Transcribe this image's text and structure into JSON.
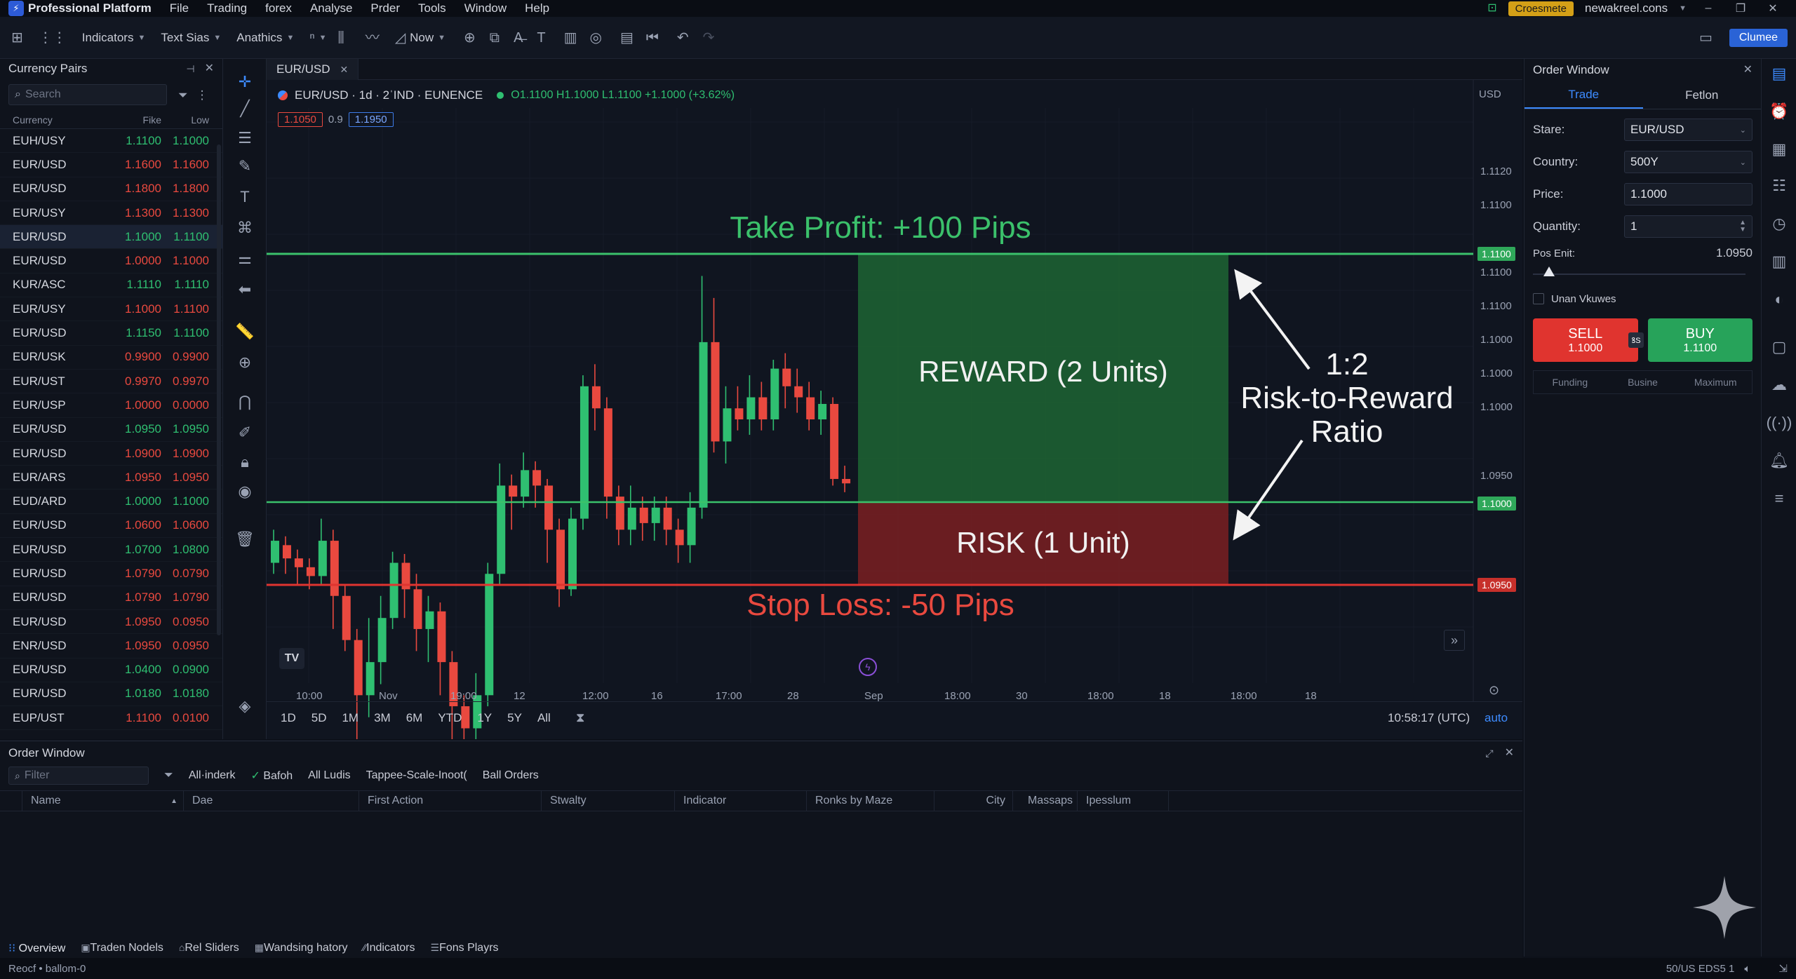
{
  "menubar": {
    "app_name": "Professional Platform",
    "items": [
      "File",
      "Trading",
      "forex",
      "Analyse",
      "Prder",
      "Tools",
      "Window",
      "Help"
    ],
    "badge": "Croesmete",
    "account": "newakreel.cons"
  },
  "toolbar": {
    "indicators": "Indicators",
    "text_size": "Text Sias",
    "analytics": "Anathics",
    "now": "Now",
    "action_button": "Clumee"
  },
  "pairs_panel": {
    "title": "Currency Pairs",
    "search_placeholder": "Search",
    "col_currency": "Currency",
    "col_price": "Fike",
    "col_low": "Low",
    "rows": [
      {
        "pair": "EUH/USY",
        "price": "1.1100",
        "low": "1.1000",
        "dir": "up"
      },
      {
        "pair": "EUR/USD",
        "price": "1.1600",
        "low": "1.1600",
        "dir": "dn"
      },
      {
        "pair": "EUR/USD",
        "price": "1.1800",
        "low": "1.1800",
        "dir": "dn"
      },
      {
        "pair": "EUR/USY",
        "price": "1.1300",
        "low": "1.1300",
        "dir": "dn"
      },
      {
        "pair": "EUR/USD",
        "price": "1.1000",
        "low": "1.1100",
        "dir": "up",
        "selected": true
      },
      {
        "pair": "EUR/USD",
        "price": "1.0000",
        "low": "1.1000",
        "dir": "dn"
      },
      {
        "pair": "KUR/ASC",
        "price": "1.1110",
        "low": "1.1110",
        "dir": "up"
      },
      {
        "pair": "EUR/USY",
        "price": "1.1000",
        "low": "1.1100",
        "dir": "dn"
      },
      {
        "pair": "EUR/USD",
        "price": "1.1150",
        "low": "1.1100",
        "dir": "up"
      },
      {
        "pair": "EUR/USK",
        "price": "0.9900",
        "low": "0.9900",
        "dir": "dn"
      },
      {
        "pair": "EUR/UST",
        "price": "0.9970",
        "low": "0.9970",
        "dir": "dn"
      },
      {
        "pair": "EUR/USP",
        "price": "1.0000",
        "low": "0.0000",
        "dir": "dn"
      },
      {
        "pair": "EUR/USD",
        "price": "1.0950",
        "low": "1.0950",
        "dir": "up"
      },
      {
        "pair": "EUR/USD",
        "price": "1.0900",
        "low": "1.0900",
        "dir": "dn"
      },
      {
        "pair": "EUR/ARS",
        "price": "1.0950",
        "low": "1.0950",
        "dir": "dn"
      },
      {
        "pair": "EUD/ARD",
        "price": "1.0000",
        "low": "1.1000",
        "dir": "up"
      },
      {
        "pair": "EUR/USD",
        "price": "1.0600",
        "low": "1.0600",
        "dir": "dn"
      },
      {
        "pair": "EUR/USD",
        "price": "1.0700",
        "low": "1.0800",
        "dir": "up"
      },
      {
        "pair": "EUR/USD",
        "price": "1.0790",
        "low": "0.0790",
        "dir": "dn"
      },
      {
        "pair": "EUR/USD",
        "price": "1.0790",
        "low": "1.0790",
        "dir": "dn"
      },
      {
        "pair": "EUR/USD",
        "price": "1.0950",
        "low": "0.0950",
        "dir": "dn"
      },
      {
        "pair": "ENR/USD",
        "price": "1.0950",
        "low": "0.0950",
        "dir": "dn"
      },
      {
        "pair": "EUR/USD",
        "price": "1.0400",
        "low": "0.0900",
        "dir": "up"
      },
      {
        "pair": "EUR/USD",
        "price": "1.0180",
        "low": "1.0180",
        "dir": "up"
      },
      {
        "pair": "EUP/UST",
        "price": "1.1100",
        "low": "0.0100",
        "dir": "dn"
      }
    ]
  },
  "chart": {
    "tab": "EUR/USD",
    "symbol_line": "EUR/USD · 1d · 2ˈIND · EUNENCE",
    "ohlc": "O1.1100  H1.1000  L1.1100  +1.1000 (+3.62%)",
    "pill_sell": "1.1050",
    "pill_mid": "0.9",
    "pill_buy": "1.1950",
    "currency_label": "USD",
    "take_profit_label": "Take Profit: +100 Pips",
    "stop_loss_label": "Stop Loss: -50 Pips",
    "reward_label": "REWARD (2 Units)",
    "risk_label": "RISK (1 Unit)",
    "ratio_line1": "1:2",
    "ratio_line2": "Risk-to-Reward",
    "ratio_line3": "Ratio",
    "tp_tag": "1.1100",
    "entry_tag": "1.1000",
    "sl_tag": "1.0950",
    "periods": [
      "1D",
      "5D",
      "1M",
      "3M",
      "6M",
      "YTD",
      "1Y",
      "5Y",
      "All"
    ],
    "clock": "10:58:17 (UTC)",
    "auto": "auto",
    "logo": "TV"
  },
  "chart_data": {
    "type": "candlestick",
    "y_axis_labels": [
      "1.1120",
      "1.1100",
      "1.1100",
      "1.1100",
      "1.1000",
      "1.1000",
      "1.1000",
      "1.0950"
    ],
    "x_axis_labels": [
      "10:00",
      "Nov",
      "19:00",
      "12",
      "12:00",
      "16",
      "17:00",
      "28",
      "Sep",
      "18:00",
      "30",
      "18:00",
      "18",
      "18:00",
      "18"
    ],
    "levels": {
      "take_profit": 1.11,
      "entry": 1.1,
      "stop_loss": 1.095
    },
    "candles": [
      {
        "o": 1.096,
        "c": 1.097,
        "h": 1.0975,
        "l": 1.0955
      },
      {
        "o": 1.0968,
        "c": 1.0962,
        "h": 1.0972,
        "l": 1.0955
      },
      {
        "o": 1.0962,
        "c": 1.0958,
        "h": 1.0966,
        "l": 1.095
      },
      {
        "o": 1.0958,
        "c": 1.0954,
        "h": 1.0962,
        "l": 1.0948
      },
      {
        "o": 1.0954,
        "c": 1.097,
        "h": 1.098,
        "l": 1.095
      },
      {
        "o": 1.097,
        "c": 1.0945,
        "h": 1.0975,
        "l": 1.093
      },
      {
        "o": 1.0945,
        "c": 1.0925,
        "h": 1.095,
        "l": 1.092
      },
      {
        "o": 1.0925,
        "c": 1.09,
        "h": 1.093,
        "l": 1.088
      },
      {
        "o": 1.09,
        "c": 1.0915,
        "h": 1.0935,
        "l": 1.089
      },
      {
        "o": 1.0915,
        "c": 1.0935,
        "h": 1.0945,
        "l": 1.0905
      },
      {
        "o": 1.0935,
        "c": 1.096,
        "h": 1.0965,
        "l": 1.093
      },
      {
        "o": 1.096,
        "c": 1.0948,
        "h": 1.0964,
        "l": 1.0935
      },
      {
        "o": 1.0948,
        "c": 1.093,
        "h": 1.0955,
        "l": 1.092
      },
      {
        "o": 1.093,
        "c": 1.0938,
        "h": 1.0945,
        "l": 1.0915
      },
      {
        "o": 1.0938,
        "c": 1.0915,
        "h": 1.0942,
        "l": 1.09
      },
      {
        "o": 1.0915,
        "c": 1.0895,
        "h": 1.092,
        "l": 1.088
      },
      {
        "o": 1.0895,
        "c": 1.0885,
        "h": 1.09,
        "l": 1.0875
      },
      {
        "o": 1.0885,
        "c": 1.09,
        "h": 1.091,
        "l": 1.088
      },
      {
        "o": 1.09,
        "c": 1.0955,
        "h": 1.096,
        "l": 1.0895
      },
      {
        "o": 1.0955,
        "c": 1.0995,
        "h": 1.1005,
        "l": 1.095
      },
      {
        "o": 1.0995,
        "c": 1.099,
        "h": 1.1,
        "l": 1.0975
      },
      {
        "o": 1.099,
        "c": 1.1002,
        "h": 1.101,
        "l": 1.0985
      },
      {
        "o": 1.1002,
        "c": 1.0995,
        "h": 1.1006,
        "l": 1.0985
      },
      {
        "o": 1.0995,
        "c": 1.0975,
        "h": 1.0998,
        "l": 1.096
      },
      {
        "o": 1.0975,
        "c": 1.0948,
        "h": 1.098,
        "l": 1.094
      },
      {
        "o": 1.0948,
        "c": 1.098,
        "h": 1.0985,
        "l": 1.0945
      },
      {
        "o": 1.098,
        "c": 1.104,
        "h": 1.1045,
        "l": 1.0975
      },
      {
        "o": 1.104,
        "c": 1.103,
        "h": 1.105,
        "l": 1.102
      },
      {
        "o": 1.103,
        "c": 1.099,
        "h": 1.1035,
        "l": 1.098
      },
      {
        "o": 1.099,
        "c": 1.0975,
        "h": 1.0995,
        "l": 1.0968
      },
      {
        "o": 1.0975,
        "c": 1.0985,
        "h": 1.0995,
        "l": 1.0968
      },
      {
        "o": 1.0985,
        "c": 1.0978,
        "h": 1.099,
        "l": 1.097
      },
      {
        "o": 1.0978,
        "c": 1.0985,
        "h": 1.099,
        "l": 1.097
      },
      {
        "o": 1.0985,
        "c": 1.0975,
        "h": 1.099,
        "l": 1.0968
      },
      {
        "o": 1.0975,
        "c": 1.0968,
        "h": 1.098,
        "l": 1.096
      },
      {
        "o": 1.0968,
        "c": 1.0985,
        "h": 1.0992,
        "l": 1.096
      },
      {
        "o": 1.0985,
        "c": 1.106,
        "h": 1.109,
        "l": 1.098
      },
      {
        "o": 1.106,
        "c": 1.1015,
        "h": 1.108,
        "l": 1.101
      },
      {
        "o": 1.1015,
        "c": 1.103,
        "h": 1.104,
        "l": 1.1005
      },
      {
        "o": 1.103,
        "c": 1.1025,
        "h": 1.104,
        "l": 1.102
      },
      {
        "o": 1.1025,
        "c": 1.1035,
        "h": 1.1045,
        "l": 1.1018
      },
      {
        "o": 1.1035,
        "c": 1.1025,
        "h": 1.1042,
        "l": 1.102
      },
      {
        "o": 1.1025,
        "c": 1.1048,
        "h": 1.1052,
        "l": 1.102
      },
      {
        "o": 1.1048,
        "c": 1.104,
        "h": 1.1055,
        "l": 1.103
      },
      {
        "o": 1.104,
        "c": 1.1035,
        "h": 1.1048,
        "l": 1.1028
      },
      {
        "o": 1.1035,
        "c": 1.1025,
        "h": 1.1042,
        "l": 1.102
      },
      {
        "o": 1.1025,
        "c": 1.1032,
        "h": 1.1038,
        "l": 1.1018
      },
      {
        "o": 1.1032,
        "c": 1.0998,
        "h": 1.1035,
        "l": 1.0995
      },
      {
        "o": 1.0998,
        "c": 1.0996,
        "h": 1.1004,
        "l": 1.0992
      }
    ]
  },
  "order_window": {
    "title": "Order Window",
    "tab_trade": "Trade",
    "tab_other": "Fetlon",
    "stare_label": "Stare:",
    "stare_value": "EUR/USD",
    "country_label": "Country:",
    "country_value": "500Y",
    "price_label": "Price:",
    "price_value": "1.1000",
    "quantity_label": "Quantity:",
    "quantity_value": "1",
    "pos_label": "Pos Enit:",
    "pos_value": "1.0950",
    "slider_fraction": 0.05,
    "checkbox_label": "Unan Vkuwes",
    "sell_label": "SELL",
    "sell_price": "1.1000",
    "buy_label": "BUY",
    "buy_price": "1.1100",
    "swap_label": "ꝸS",
    "footer": [
      "Funding",
      "Busine",
      "Maximum"
    ]
  },
  "bottom_panel": {
    "title": "Order Window",
    "filter_placeholder": "Filter",
    "filters": [
      "All·inderk",
      "Bafoh",
      "All Ludis",
      "Tappee-Scale-Inoot(",
      "Ball Orders"
    ],
    "columns": [
      "Name",
      "Dae",
      "First Action",
      "Stwalty",
      "Indicator",
      "Ronks by Maze",
      "City",
      "Massaps",
      "Ipesslum"
    ],
    "tabs": [
      "Overview",
      "Traden Nodels",
      "Rel Sliders",
      "Wandsing hatory",
      "Indicators",
      "Fons Playrs"
    ]
  },
  "status": {
    "left": "Reocf • ballom-0",
    "right": "50/US EDS5 1"
  },
  "colors": {
    "bull": "#2fbf71",
    "bear": "#e9493f",
    "accent": "#3d8bff",
    "tp": "#3bc16b",
    "sl": "#e0342f"
  }
}
